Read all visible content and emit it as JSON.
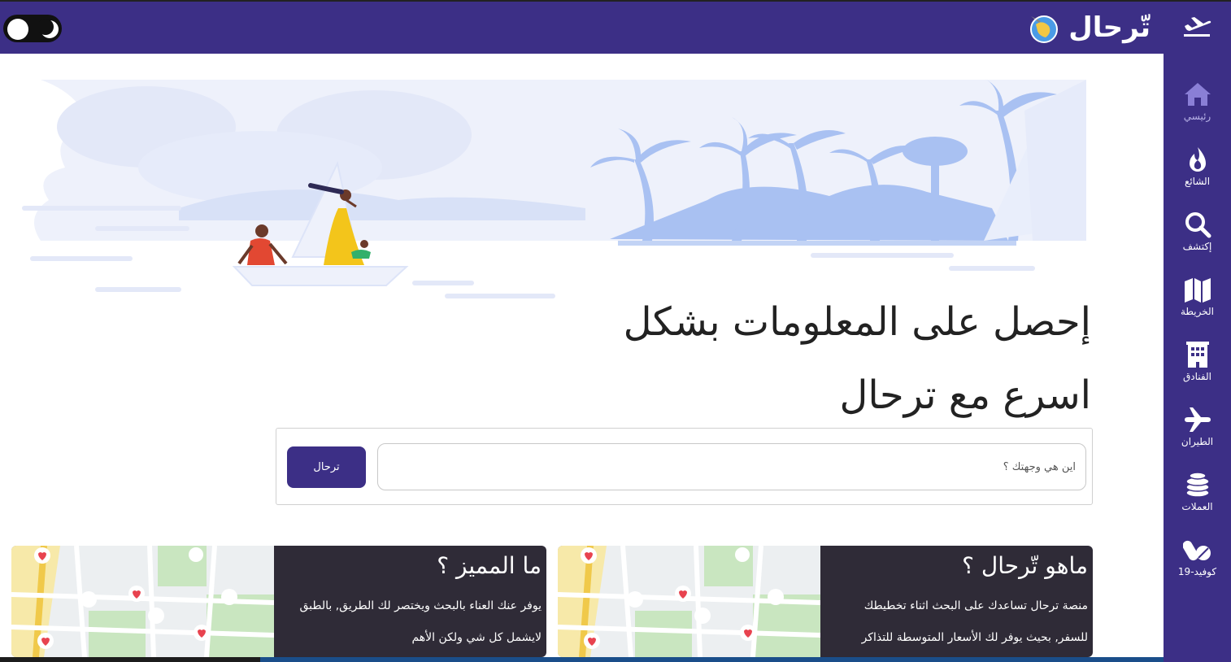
{
  "header": {
    "brand_name": "تّرحال",
    "theme_toggle": "dark-mode-toggle"
  },
  "sidebar": {
    "items": [
      {
        "label": "رئيسي",
        "icon": "home-icon",
        "active": true
      },
      {
        "label": "الشائع",
        "icon": "fire-icon"
      },
      {
        "label": "إكتشف",
        "icon": "search-icon"
      },
      {
        "label": "الخريطة",
        "icon": "map-icon"
      },
      {
        "label": "الفنادق",
        "icon": "hotel-icon"
      },
      {
        "label": "الطيران",
        "icon": "plane-icon"
      },
      {
        "label": "العملات",
        "icon": "coins-icon"
      },
      {
        "label": "كوفيد-19",
        "icon": "pills-icon"
      }
    ]
  },
  "hero": {
    "headline_line1": "إحصل على المعلومات بشكل",
    "headline_line2": "اسرع مع ترحال"
  },
  "search": {
    "placeholder": "اين هي وجهتك ؟",
    "button_label": "ترحال"
  },
  "cards": [
    {
      "title": "ماهو تّرحال ؟",
      "line1": "منصة ترحال تساعدك على البحث اثناء تخطيطك",
      "line2": "للسفر, بحيث يوفر لك الأسعار المتوسطة للتذاكر"
    },
    {
      "title": "ما المميز ؟",
      "line1": "يوفر عنك العناء بالبحث ويختصر لك الطريق, بالطبق",
      "line2": "لايشمل كل شي ولكن الأهم"
    }
  ],
  "colors": {
    "primary": "#3c2f86",
    "card_bg": "#2f2b37",
    "hero_light": "#e6ebfa",
    "hero_mid": "#a9c1f2",
    "heart": "#e8434f"
  }
}
